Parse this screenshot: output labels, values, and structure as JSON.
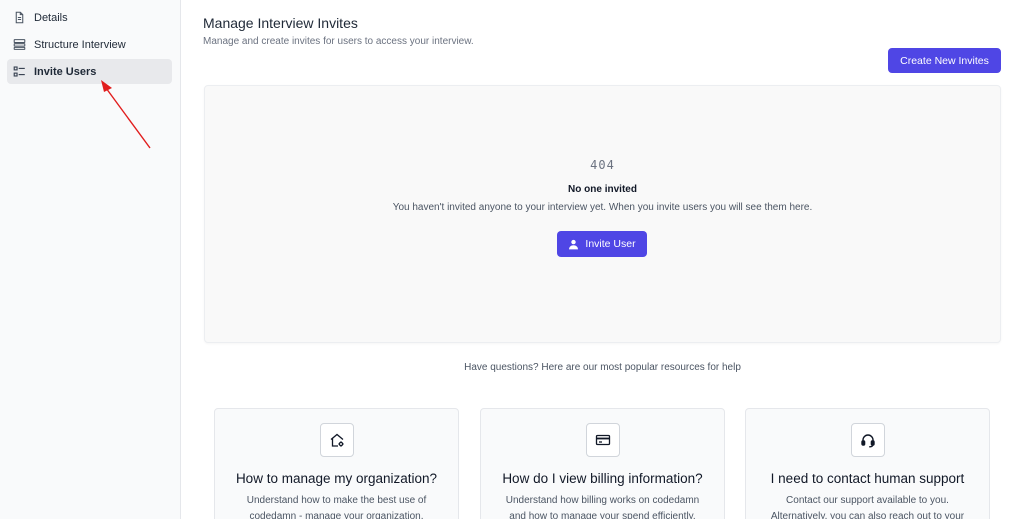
{
  "sidebar": {
    "items": [
      {
        "label": "Details",
        "icon": "document-icon"
      },
      {
        "label": "Structure Interview",
        "icon": "layout-icon"
      },
      {
        "label": "Invite Users",
        "icon": "list-icon",
        "active": true
      }
    ]
  },
  "header": {
    "title": "Manage Interview Invites",
    "subtitle": "Manage and create invites for users to access your interview.",
    "create_button": "Create New Invites"
  },
  "empty_state": {
    "code": "404",
    "title": "No one invited",
    "description": "You haven't invited anyone to your interview yet. When you invite users you will see them here.",
    "invite_button": "Invite User"
  },
  "help": {
    "heading": "Have questions? Here are our most popular resources for help",
    "cards": [
      {
        "icon": "home-gear-icon",
        "title": "How to manage my organization?",
        "line1": "Understand how to make the best use of",
        "line2": "codedamn - manage your organization,"
      },
      {
        "icon": "credit-card-icon",
        "title": "How do I view billing information?",
        "line1": "Understand how billing works on codedamn",
        "line2": "and how to manage your spend efficiently."
      },
      {
        "icon": "headset-icon",
        "title": "I need to contact human support",
        "line1": "Contact our support available to you.",
        "line2": "Alternatively, you can also reach out to your"
      }
    ]
  },
  "colors": {
    "accent": "#4f46e5",
    "annotation_arrow": "#e11d1d"
  }
}
